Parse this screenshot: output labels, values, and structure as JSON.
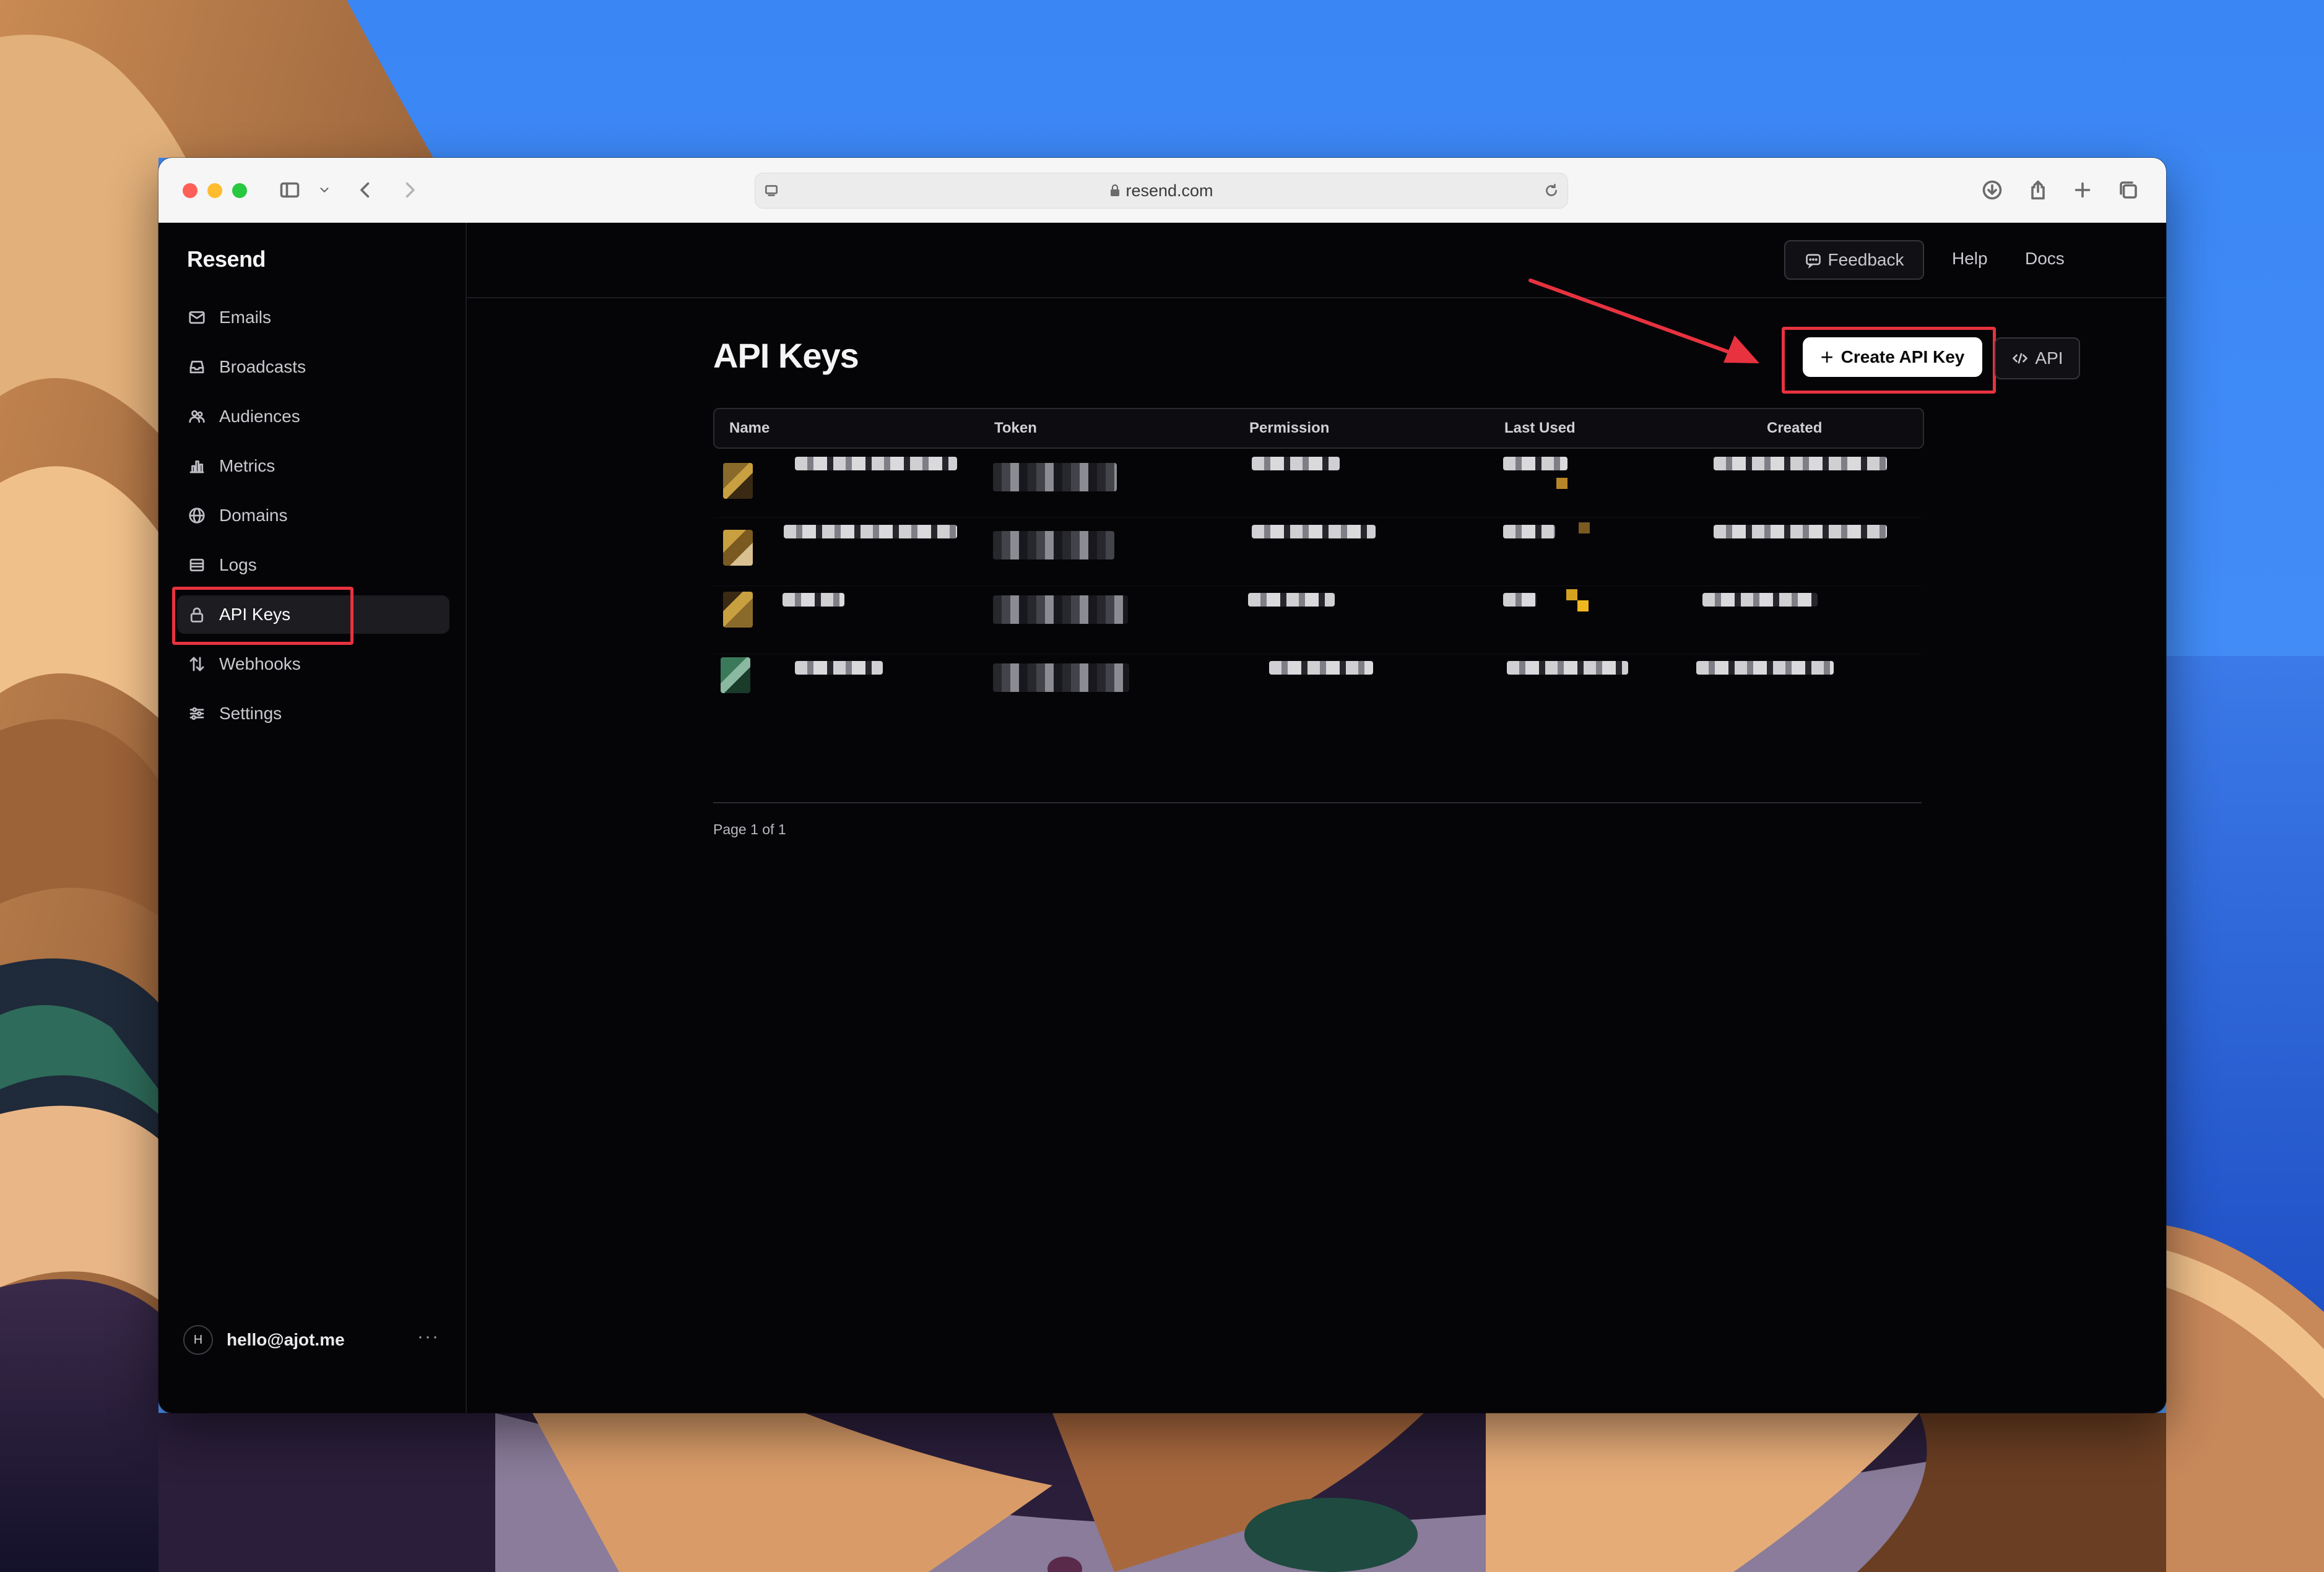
{
  "browser": {
    "url": "resend.com",
    "toolbar_icons": [
      "sidebar-icon",
      "chevron-down-icon",
      "back-icon",
      "forward-icon",
      "reader-icon",
      "reload-icon",
      "download-icon",
      "share-icon",
      "new-tab-icon",
      "tabs-icon"
    ]
  },
  "sidebar": {
    "brand": "Resend",
    "items": [
      {
        "label": "Emails",
        "icon": "mail-icon"
      },
      {
        "label": "Broadcasts",
        "icon": "inbox-icon"
      },
      {
        "label": "Audiences",
        "icon": "users-icon"
      },
      {
        "label": "Metrics",
        "icon": "bar-chart-icon"
      },
      {
        "label": "Domains",
        "icon": "globe-icon"
      },
      {
        "label": "Logs",
        "icon": "logs-icon"
      },
      {
        "label": "API Keys",
        "icon": "lock-icon",
        "active": true
      },
      {
        "label": "Webhooks",
        "icon": "webhook-icon"
      },
      {
        "label": "Settings",
        "icon": "sliders-icon"
      }
    ],
    "user": {
      "initial": "H",
      "email": "hello@ajot.me",
      "more": "···"
    }
  },
  "topbar": {
    "feedback": "Feedback",
    "help": "Help",
    "docs": "Docs"
  },
  "main": {
    "title": "API Keys",
    "create_button": "Create API Key",
    "create_icon": "+",
    "api_button": "API",
    "table": {
      "columns": [
        "Name",
        "Token",
        "Permission",
        "Last Used",
        "Created"
      ],
      "rows_note": "4 rows, content pixelated"
    },
    "pager": "Page 1 of 1"
  },
  "annotations": {
    "highlight_color": "#e8323f"
  },
  "colors": {
    "app_bg": "#050508",
    "accent_button": "#ffffff",
    "annotation_red": "#e8323f"
  }
}
